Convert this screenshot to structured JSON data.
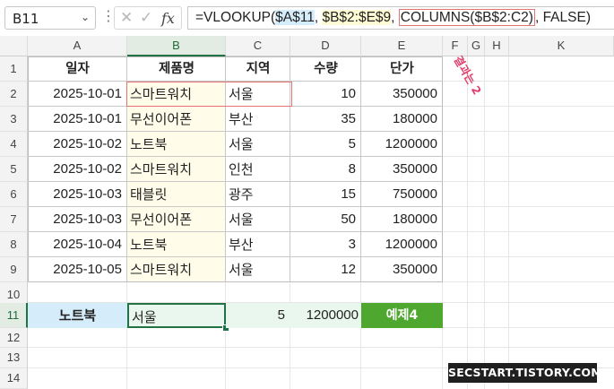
{
  "formula_bar": {
    "name_box": "B11",
    "formula_parts": [
      "=VLOOKUP(",
      "$A$11",
      ", ",
      "$B$2:$E$9",
      ", ",
      "COLUMNS($B$2:C2)",
      ", FALSE)"
    ],
    "fx_label": "fx"
  },
  "columns": [
    "A",
    "B",
    "C",
    "D",
    "E",
    "F",
    "G",
    "H",
    "K"
  ],
  "rows": [
    "1",
    "2",
    "3",
    "4",
    "5",
    "6",
    "7",
    "8",
    "9",
    "10",
    "11",
    "12",
    "13",
    "14"
  ],
  "headers": [
    "일자",
    "제품명",
    "지역",
    "수량",
    "단가"
  ],
  "data": [
    [
      "2025-10-01",
      "스마트워치",
      "서울",
      "10",
      "350000"
    ],
    [
      "2025-10-01",
      "무선이어폰",
      "부산",
      "35",
      "180000"
    ],
    [
      "2025-10-02",
      "노트북",
      "서울",
      "5",
      "1200000"
    ],
    [
      "2025-10-02",
      "스마트워치",
      "인천",
      "8",
      "350000"
    ],
    [
      "2025-10-03",
      "태블릿",
      "광주",
      "15",
      "750000"
    ],
    [
      "2025-10-03",
      "무선이어폰",
      "서울",
      "50",
      "180000"
    ],
    [
      "2025-10-04",
      "노트북",
      "부산",
      "3",
      "1200000"
    ],
    [
      "2025-10-05",
      "스마트워치",
      "서울",
      "12",
      "350000"
    ]
  ],
  "lookup_row": {
    "key": "노트북",
    "region": "서울",
    "qty": "5",
    "price": "1200000",
    "example_label": "예제4"
  },
  "annotation": "결과는 2",
  "watermark": "SECSTART.TISTORY.COM",
  "colors": {
    "accent_green": "#217346",
    "example_bg": "#4ea72e",
    "lookup_key_bg": "#d5ecfb",
    "lookup_row_bg": "#eaf7ee",
    "col_b_bg": "#fffdea",
    "annotation": "#e0406b"
  }
}
